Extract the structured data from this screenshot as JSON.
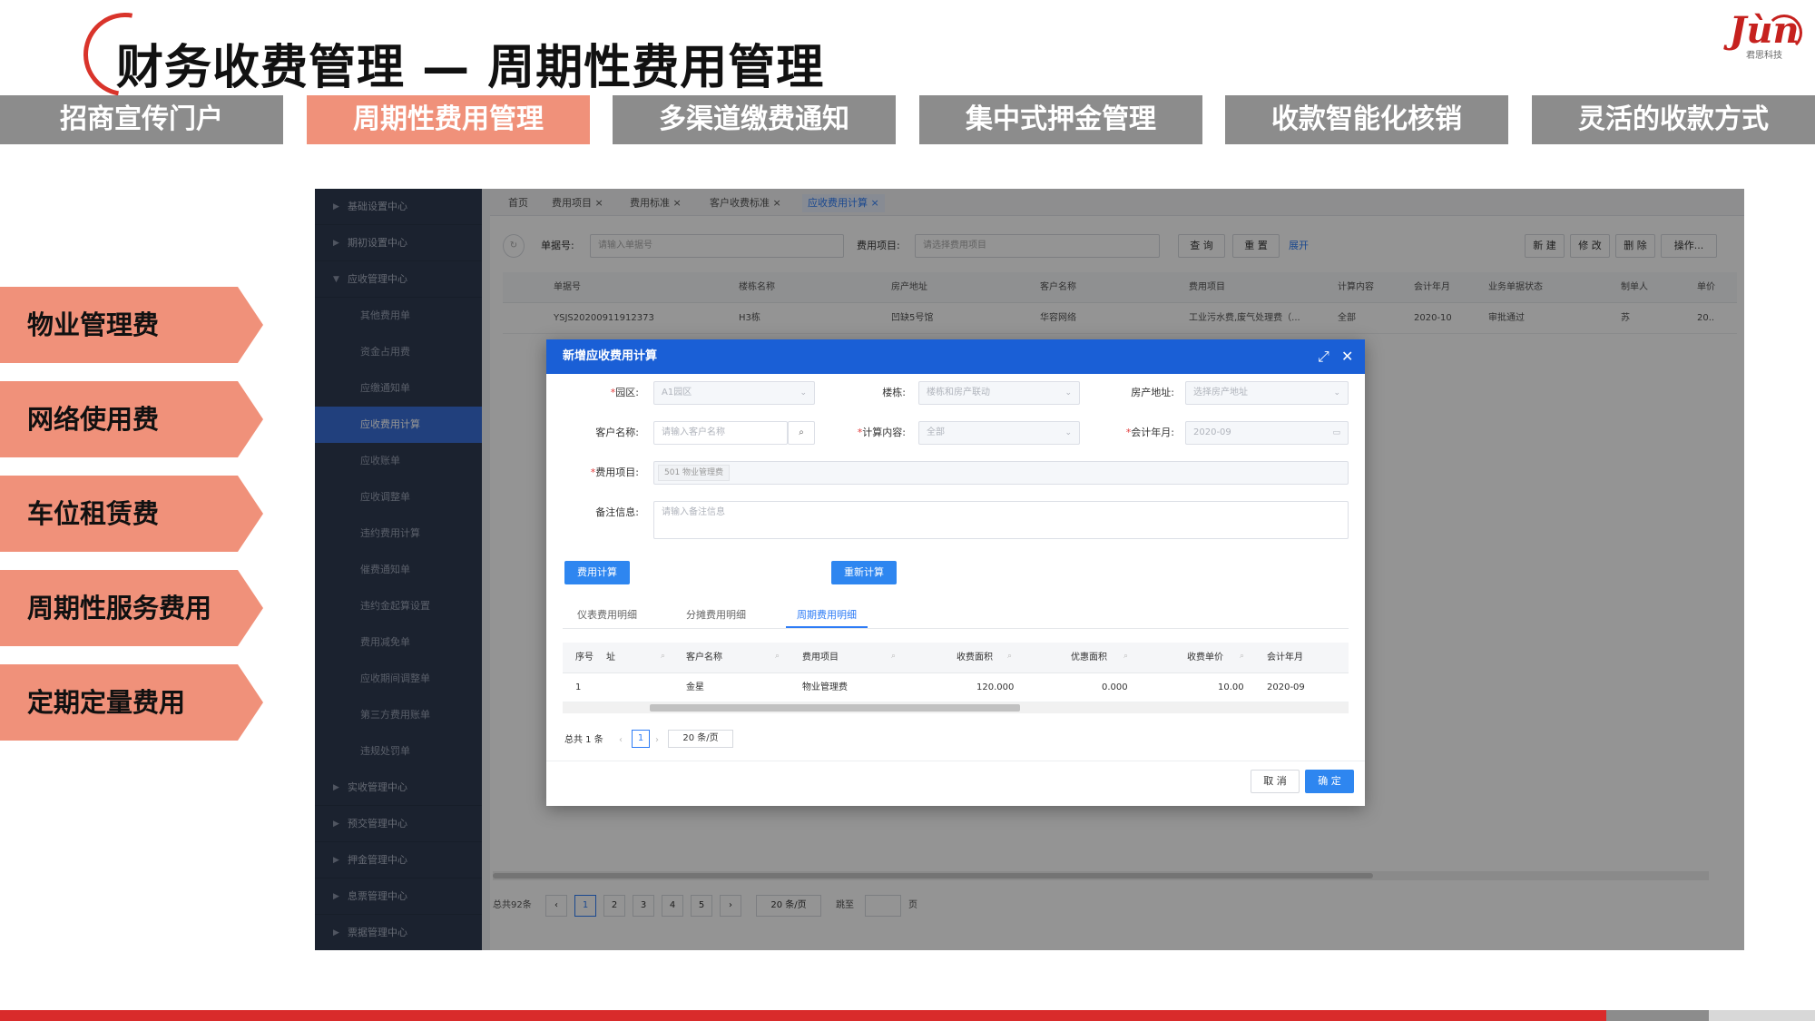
{
  "header": {
    "title": "财务收费管理 — 周期性费用管理",
    "logo_text": "Jùn",
    "logo_sub": "君思科技"
  },
  "tabs": [
    {
      "label": "招商宣传门户",
      "active": false
    },
    {
      "label": "周期性费用管理",
      "active": true
    },
    {
      "label": "多渠道缴费通知",
      "active": false
    },
    {
      "label": "集中式押金管理",
      "active": false
    },
    {
      "label": "收款智能化核销",
      "active": false
    },
    {
      "label": "灵活的收款方式",
      "active": false
    }
  ],
  "fee_types": [
    "物业管理费",
    "网络使用费",
    "车位租赁费",
    "周期性服务费用",
    "定期定量费用"
  ],
  "colors": {
    "accent": "#f0917a",
    "tab_gray": "#8c8c8c",
    "brand_red": "#d92b2b",
    "dialog_blue": "#1a5fd6",
    "primary_button": "#2e86f0"
  },
  "app": {
    "sidebar": [
      {
        "label": "基础设置中心",
        "type": "top"
      },
      {
        "label": "期初设置中心",
        "type": "top"
      },
      {
        "label": "应收管理中心",
        "type": "top-open"
      },
      {
        "label": "其他费用单",
        "type": "sub"
      },
      {
        "label": "资金占用费",
        "type": "sub"
      },
      {
        "label": "应缴通知单",
        "type": "sub"
      },
      {
        "label": "应收费用计算",
        "type": "sub-active"
      },
      {
        "label": "应收账单",
        "type": "sub"
      },
      {
        "label": "应收调整单",
        "type": "sub"
      },
      {
        "label": "违约费用计算",
        "type": "sub"
      },
      {
        "label": "催费通知单",
        "type": "sub"
      },
      {
        "label": "违约金起算设置",
        "type": "sub"
      },
      {
        "label": "费用减免单",
        "type": "sub"
      },
      {
        "label": "应收期间调整单",
        "type": "sub"
      },
      {
        "label": "第三方费用账单",
        "type": "sub"
      },
      {
        "label": "违规处罚单",
        "type": "sub"
      },
      {
        "label": "实收管理中心",
        "type": "top"
      },
      {
        "label": "预交管理中心",
        "type": "top"
      },
      {
        "label": "押金管理中心",
        "type": "top"
      },
      {
        "label": "息票管理中心",
        "type": "top"
      },
      {
        "label": "票据管理中心",
        "type": "top"
      }
    ],
    "page_tabs": [
      "首页",
      "费用项目 ×",
      "费用标准 ×",
      "客户收费标准 ×",
      "应收费用计算 ×"
    ],
    "search": {
      "bill_no_label": "单据号:",
      "bill_no_placeholder": "请输入单据号",
      "fee_item_label": "费用项目:",
      "fee_item_placeholder": "请选择费用项目",
      "query": "查 询",
      "reset": "重 置",
      "expand": "展开",
      "new": "新 建",
      "modify": "修 改",
      "delete": "删 除",
      "ops": "操作..."
    },
    "grid": {
      "headers": [
        "单据号",
        "楼栋名称",
        "房产地址",
        "客户名称",
        "费用项目",
        "计算内容",
        "会计年月",
        "业务单据状态",
        "制单人",
        "单价"
      ],
      "row": [
        "YSJS20200911912373",
        "H3栋",
        "凹缺5号馆",
        "华容网络",
        "工业污水费,废气处理费（...",
        "全部",
        "2020-10",
        "审批通过",
        "苏",
        "20.."
      ]
    },
    "pager": {
      "total": "总共92条",
      "pages": [
        "1",
        "2",
        "3",
        "4",
        "5"
      ],
      "size": "20 条/页",
      "jump": "跳至",
      "page_unit": "页"
    }
  },
  "dialog": {
    "title": "新增应收费用计算",
    "fields": {
      "park_label": "园区:",
      "park_value": "A1园区",
      "building_label": "楼栋:",
      "building_placeholder": "楼栋和房产联动",
      "address_label": "房产地址:",
      "address_placeholder": "选择房产地址",
      "customer_label": "客户名称:",
      "customer_placeholder": "请输入客户名称",
      "calc_label": "计算内容:",
      "calc_value": "全部",
      "period_label": "会计年月:",
      "period_value": "2020-09",
      "fee_item_label": "费用项目:",
      "fee_item_tag": "501 物业管理费",
      "remark_label": "备注信息:",
      "remark_placeholder": "请输入备注信息"
    },
    "calc_button": "费用计算",
    "recalc_button": "重新计算",
    "detail_tabs": [
      "仪表费用明细",
      "分摊费用明细",
      "周期费用明细"
    ],
    "table": {
      "headers": [
        "序号",
        "址",
        "客户名称",
        "费用项目",
        "收费面积",
        "优惠面积",
        "收费单价",
        "会计年月"
      ],
      "row": [
        "1",
        "",
        "金星",
        "物业管理费",
        "120.000",
        "0.000",
        "10.00",
        "2020-09"
      ]
    },
    "pager": {
      "total": "总共 1 条",
      "page": "1",
      "size": "20 条/页"
    },
    "cancel": "取 消",
    "ok": "确 定"
  }
}
